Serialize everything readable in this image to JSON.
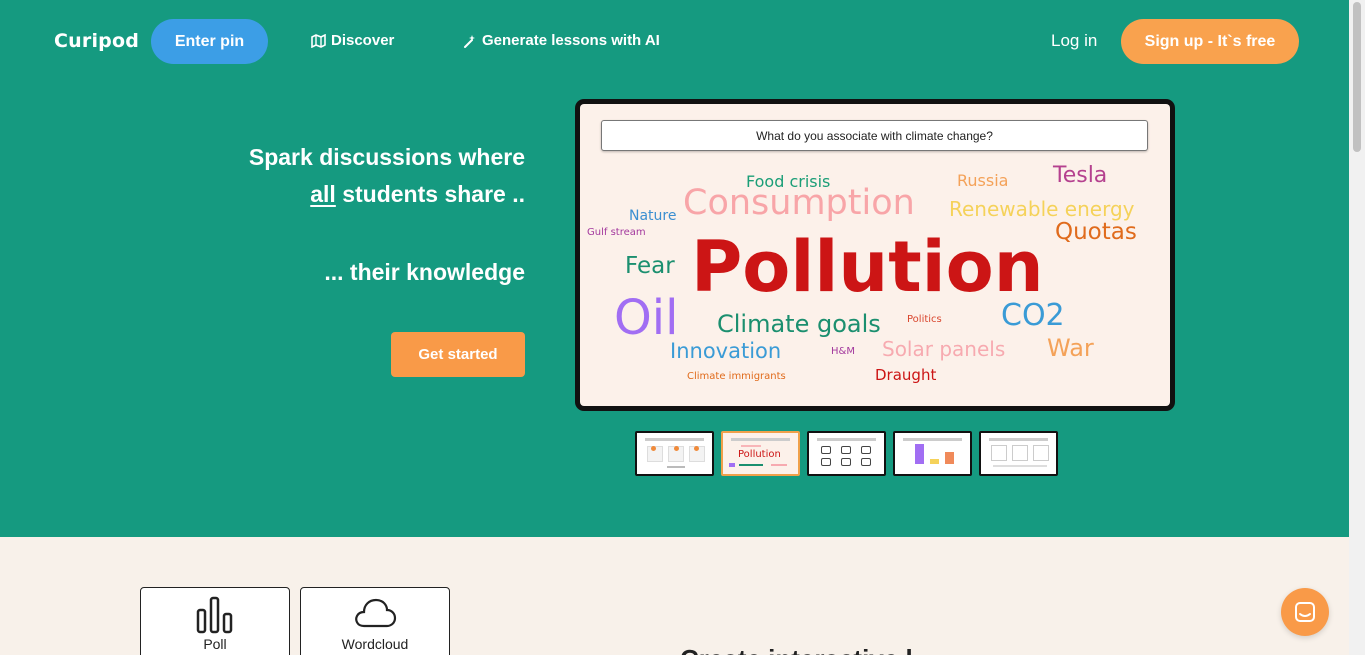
{
  "nav": {
    "logo": "Curipod",
    "enter_pin": "Enter pin",
    "discover": "Discover",
    "generate": "Generate lessons with AI",
    "login": "Log in",
    "signup": "Sign up - It`s free"
  },
  "hero": {
    "line1": "Spark discussions where",
    "line2_em": "all",
    "line2_rest": " students share ..",
    "line3": "... their knowledge",
    "cta": "Get started"
  },
  "slide": {
    "question": "What do you associate with climate change?",
    "words": [
      {
        "text": "Food crisis",
        "color": "#1b9e77"
      },
      {
        "text": "Russia",
        "color": "#f4a259"
      },
      {
        "text": "Tesla",
        "color": "#b5418f"
      },
      {
        "text": "Consumption",
        "color": "#f8a5a8"
      },
      {
        "text": "Nature",
        "color": "#3b8fd1"
      },
      {
        "text": "Renewable energy",
        "color": "#f5d25a"
      },
      {
        "text": "Gulf stream",
        "color": "#a3399e"
      },
      {
        "text": "Quotas",
        "color": "#e06b1c"
      },
      {
        "text": "Fear",
        "color": "#1b8f6f"
      },
      {
        "text": "Pollution",
        "color": "#cc1515"
      },
      {
        "text": "Oil",
        "color": "#a16ef3"
      },
      {
        "text": "Climate goals",
        "color": "#1b8f6f"
      },
      {
        "text": "Politics",
        "color": "#d9462e"
      },
      {
        "text": "CO2",
        "color": "#3a9bd6"
      },
      {
        "text": "Innovation",
        "color": "#3a9bd6"
      },
      {
        "text": "H&M",
        "color": "#a3399e"
      },
      {
        "text": "Solar panels",
        "color": "#f7aab0"
      },
      {
        "text": "War",
        "color": "#f4a259"
      },
      {
        "text": "Climate immigrants",
        "color": "#e06b1c"
      },
      {
        "text": "Draught",
        "color": "#cc1515"
      }
    ]
  },
  "thumbnails": {
    "pollution_word": "Pollution"
  },
  "cards": [
    {
      "label": "Poll",
      "icon": "bar-chart-icon"
    },
    {
      "label": "Wordcloud",
      "icon": "cloud-icon"
    }
  ],
  "bottom_heading": "Create interactive l",
  "colors": {
    "hero_bg": "#159a80",
    "pin_button": "#3c9ee6",
    "accent_orange": "#f9a24e",
    "page_bg": "#f8f1ea"
  }
}
